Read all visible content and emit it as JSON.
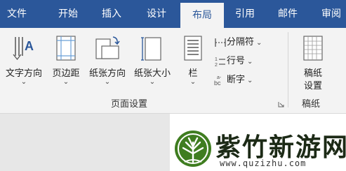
{
  "tabs": [
    {
      "label": "文件"
    },
    {
      "label": "开始"
    },
    {
      "label": "插入"
    },
    {
      "label": "设计"
    },
    {
      "label": "布局"
    },
    {
      "label": "引用"
    },
    {
      "label": "邮件"
    },
    {
      "label": "审阅"
    }
  ],
  "active_tab": "布局",
  "page_setup": {
    "text_direction": "文字方向",
    "margins": "页边距",
    "orientation": "纸张方向",
    "size": "纸张大小",
    "columns": "栏",
    "breaks": "分隔符",
    "line_numbers": "行号",
    "hyphenation": "断字",
    "group_label": "页面设置"
  },
  "manuscript": {
    "button_line1": "稿纸",
    "button_line2": "设置",
    "group_label": "稿纸"
  },
  "watermark": {
    "name": "紫竹新游网",
    "url": "www.quzizhu.com"
  },
  "colors": {
    "tab_bar": "#2b579a",
    "ribbon": "#f3f3f3",
    "logo_green": "#3f7d20"
  }
}
